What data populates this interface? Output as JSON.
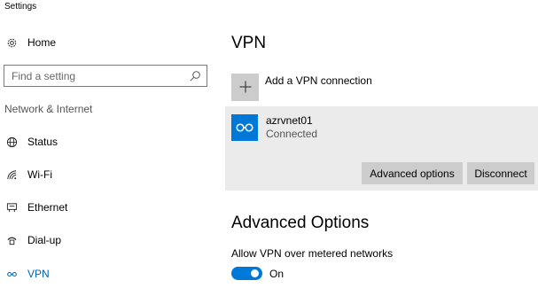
{
  "window": {
    "title": "Settings"
  },
  "sidebar": {
    "home_label": "Home",
    "search_placeholder": "Find a setting",
    "section_label": "Network & Internet",
    "items": [
      {
        "label": "Status",
        "icon": "globe-icon"
      },
      {
        "label": "Wi-Fi",
        "icon": "wifi-icon"
      },
      {
        "label": "Ethernet",
        "icon": "ethernet-icon"
      },
      {
        "label": "Dial-up",
        "icon": "dialup-icon"
      },
      {
        "label": "VPN",
        "icon": "vpn-icon",
        "active": true
      }
    ]
  },
  "main": {
    "title": "VPN",
    "add_label": "Add a VPN connection",
    "connection": {
      "name": "azrvnet01",
      "status": "Connected",
      "advanced_button": "Advanced options",
      "disconnect_button": "Disconnect"
    },
    "advanced": {
      "title": "Advanced Options",
      "metered_label": "Allow VPN over metered networks",
      "metered_state": "On"
    }
  },
  "colors": {
    "accent": "#0078d7",
    "active_nav": "#0063b1",
    "card_bg": "#ebebeb",
    "button_bg": "#cccccc"
  }
}
